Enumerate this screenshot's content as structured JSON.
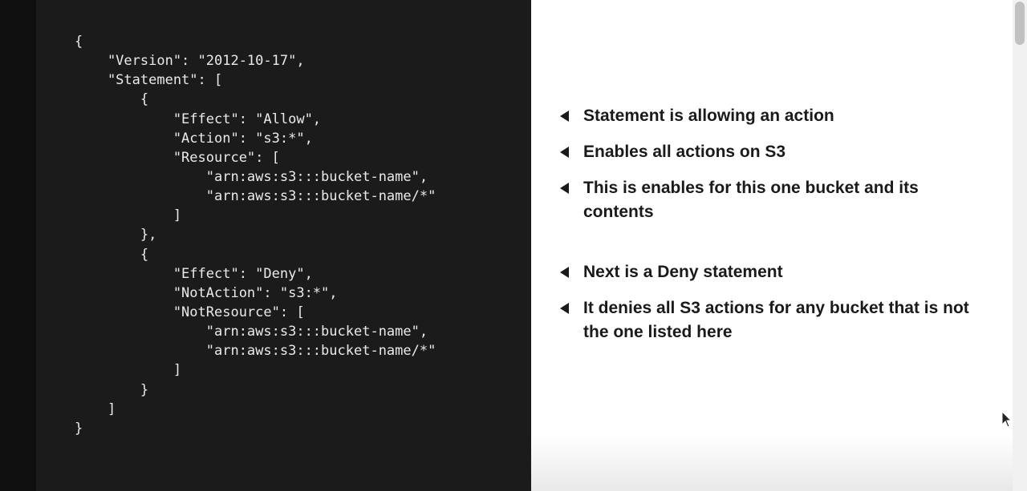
{
  "code_panel": {
    "lines": [
      "{",
      "    \"Version\": \"2012-10-17\",",
      "    \"Statement\": [",
      "        {",
      "            \"Effect\": \"Allow\",",
      "            \"Action\": \"s3:*\",",
      "            \"Resource\": [",
      "                \"arn:aws:s3:::bucket-name\",",
      "                \"arn:aws:s3:::bucket-name/*\"",
      "            ]",
      "        },",
      "        {",
      "            \"Effect\": \"Deny\",",
      "            \"NotAction\": \"s3:*\",",
      "            \"NotResource\": [",
      "                \"arn:aws:s3:::bucket-name\",",
      "                \"arn:aws:s3:::bucket-name/*\"",
      "            ]",
      "        }",
      "    ]",
      "}"
    ]
  },
  "notes": [
    "Statement is allowing an action",
    "Enables all actions on S3",
    "This is enables for this one bucket and its contents",
    "Next is a Deny statement",
    "It denies all S3 actions for any bucket that is not the one listed here"
  ],
  "icons": {
    "bullet": "left-triangle-arrow-icon",
    "pointer": "mouse-cursor-icon"
  },
  "colors": {
    "code_background": "#1b1b1b",
    "code_text": "#eaeaea",
    "notes_background": "#ffffff",
    "notes_text": "#1a1a1a"
  }
}
